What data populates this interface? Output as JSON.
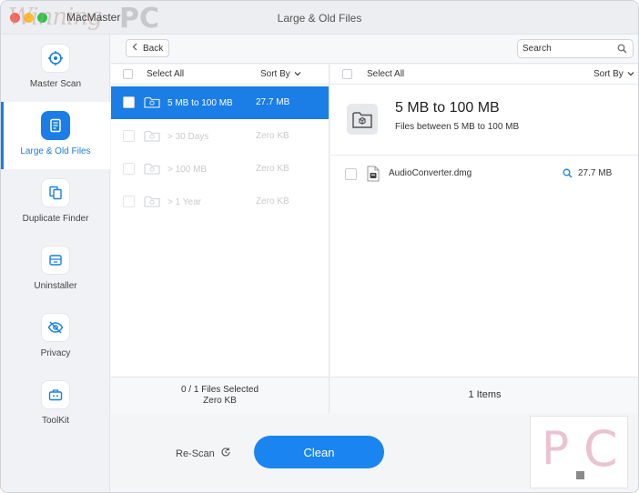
{
  "window": {
    "app_name": "MacMaster",
    "title": "Large & Old Files",
    "watermark": "PC"
  },
  "sidebar": {
    "items": [
      {
        "label": "Master Scan",
        "icon": "target-icon",
        "active": false
      },
      {
        "label": "Large & Old Files",
        "icon": "document-icon",
        "active": true
      },
      {
        "label": "Duplicate Finder",
        "icon": "copy-icon",
        "active": false
      },
      {
        "label": "Uninstaller",
        "icon": "box-icon",
        "active": false
      },
      {
        "label": "Privacy",
        "icon": "eye-slash-icon",
        "active": false
      },
      {
        "label": "ToolKit",
        "icon": "toolbox-icon",
        "active": false
      }
    ]
  },
  "toolbar": {
    "back_label": "Back",
    "search_placeholder": "Search"
  },
  "left_list": {
    "select_all": "Select All",
    "sort_by": "Sort By",
    "rows": [
      {
        "name": "5 MB to 100 MB",
        "size": "27.7 MB",
        "selected": true
      },
      {
        "name": "> 30 Days",
        "size": "Zero KB",
        "selected": false
      },
      {
        "name": "> 100 MB",
        "size": "Zero KB",
        "selected": false
      },
      {
        "name": "> 1 Year",
        "size": "Zero KB",
        "selected": false
      }
    ],
    "footer_line1": "0 / 1 Files Selected",
    "footer_line2": "Zero KB"
  },
  "right_list": {
    "select_all": "Select All",
    "sort_by": "Sort By",
    "category_title": "5 MB to 100 MB",
    "category_subtitle": "Files between 5 MB to 100 MB",
    "files": [
      {
        "name": "AudioConverter.dmg",
        "size": "27.7 MB",
        "icon": "disk-image-icon"
      }
    ],
    "footer": "1 Items"
  },
  "actions": {
    "rescan_label": "Re-Scan",
    "clean_label": "Clean"
  },
  "colors": {
    "accent": "#1a7ee6",
    "clean_button": "#1a84f0",
    "sidebar_bg": "#f1f2f5"
  }
}
